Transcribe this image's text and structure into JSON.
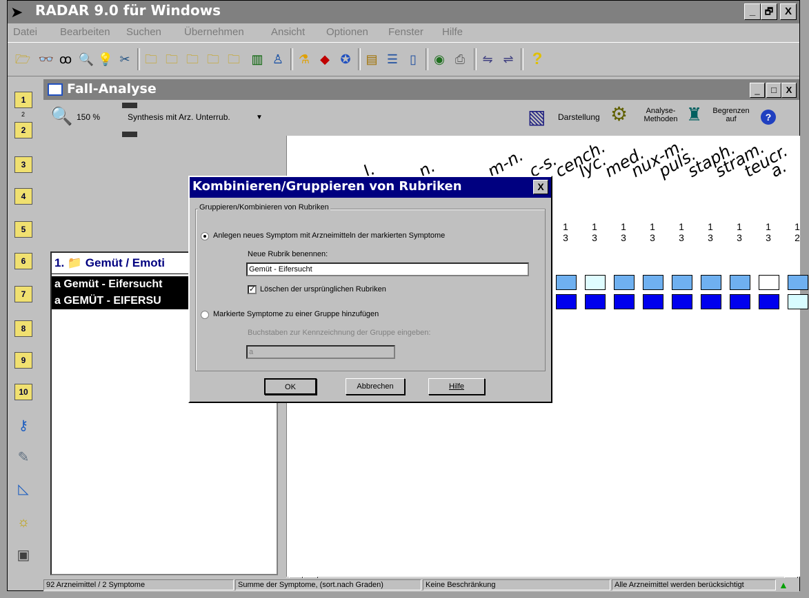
{
  "app": {
    "title": "RADAR 9.0 für Windows",
    "minimize": "_",
    "restore": "🗗",
    "close": "X"
  },
  "menu": [
    "Datei",
    "Bearbeiten",
    "Suchen",
    "Übernehmen",
    "Ansicht",
    "Optionen",
    "Fenster",
    "Hilfe"
  ],
  "sidebar": {
    "badge_2": "2",
    "items": [
      "1",
      "2",
      "3",
      "4",
      "5",
      "6",
      "7",
      "8",
      "9",
      "10"
    ]
  },
  "window": {
    "title": "Fall-Analyse",
    "zoom": "150 %",
    "analysis_select": "Synthesis mit Arz. Unterrub.",
    "darstellung": "Darstellung",
    "methoden_line1": "Analyse-",
    "methoden_line2": "Methoden",
    "begrenzen_line1": "Begrenzen",
    "begrenzen_line2": "auf",
    "help_glyph": "?"
  },
  "list": {
    "header": "1. 📁 Gemüt / Emoti",
    "rows": [
      "a Gemüt - Eifersucht",
      "a GEMÜT - EIFERSU"
    ]
  },
  "grid": {
    "remedies": [
      "l.",
      "n.",
      "m-n.",
      "c-s.",
      "cench.",
      "lyc.",
      "med.",
      "nux-m.",
      "puls.",
      "staph.",
      "stram.",
      "teucr.",
      "a."
    ],
    "top_nums": [
      "1",
      "1",
      "1",
      "1",
      "1",
      "1",
      "1",
      "1",
      "1"
    ],
    "bottom_nums": [
      "3",
      "3",
      "3",
      "3",
      "3",
      "3",
      "3",
      "3",
      "2"
    ],
    "row1_colors": [
      "#6fb0f0",
      "#dffcff",
      "#6fb0f0",
      "#6fb0f0",
      "#6fb0f0",
      "#6fb0f0",
      "#6fb0f0",
      "#ffffff",
      "#6fb0f0"
    ],
    "row2_colors": [
      "#0000ee",
      "#0000ee",
      "#0000ee",
      "#0000ee",
      "#0000ee",
      "#0000ee",
      "#0000ee",
      "#0000ee",
      "#d8fcff"
    ]
  },
  "status": {
    "count": "92 Arzneimittel / 2 Symptome",
    "sort": "Summe der Symptome, (sort.nach Graden)",
    "limit": "Keine Beschränkung",
    "remedies": "Alle Arzneimittel werden berücksichtigt"
  },
  "dialog": {
    "title": "Kombinieren/Gruppieren von Rubriken",
    "close": "X",
    "group_label": "Gruppieren/Kombinieren von Rubriken",
    "option1": "Anlegen neues Symptom mit Arzneimitteln der markierten Symptome",
    "name_label": "Neue Rubrik benennen:",
    "name_value": "Gemüt - Eifersucht",
    "delete_label": "Löschen der ursprünglichen Rubriken",
    "option2": "Markierte Symptome zu einer Gruppe hinzufügen",
    "letters_label": "Buchstaben zur Kennzeichnung der Gruppe eingeben:",
    "letters_value": "a",
    "ok": "OK",
    "cancel": "Abbrechen",
    "help": "Hilfe"
  }
}
